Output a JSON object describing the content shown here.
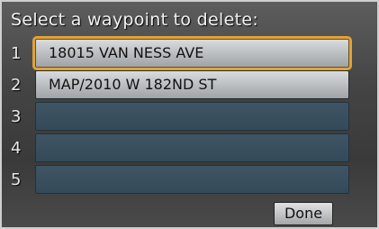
{
  "title": "Select a waypoint to delete:",
  "waypoints": [
    {
      "num": "1",
      "label": "18015 VAN NESS AVE"
    },
    {
      "num": "2",
      "label": "MAP/2010 W 182ND ST"
    },
    {
      "num": "3",
      "label": ""
    },
    {
      "num": "4",
      "label": ""
    },
    {
      "num": "5",
      "label": ""
    }
  ],
  "done_label": "Done",
  "colors": {
    "selection_outline": "#e0a23a",
    "empty_slot": "#3f5564"
  }
}
